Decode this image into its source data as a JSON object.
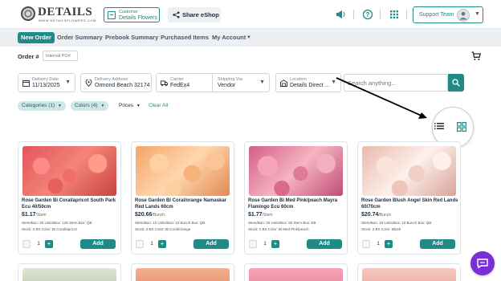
{
  "brand": {
    "logo_text": "DETAILS",
    "logo_subtext": "WWW.DETAILSFLOWERS.COM"
  },
  "header": {
    "customer_label": "Customer",
    "customer_value": "Details Flowers",
    "share_label": "Share eShop",
    "support_label": "Support Team"
  },
  "nav": {
    "items": [
      "New Order",
      "Order Summary",
      "Prebook Summary",
      "Purchased Items",
      "My Account"
    ]
  },
  "order": {
    "label": "Order #",
    "po_placeholder": "Internal PO#"
  },
  "filters": {
    "delivery_date_label": "Delivery Date",
    "delivery_date_value": "11/13/2025",
    "delivery_address_label": "Delivery Address",
    "delivery_address_value": "Ormond Beach 32174",
    "carrier_label": "Carrier",
    "carrier_value": "FedEx4",
    "shipping_via_label": "Shipping Via",
    "shipping_via_value": "Vendor",
    "location_label": "Location",
    "location_value": "Details Direct ...",
    "search_placeholder": "Search anything..."
  },
  "chips": {
    "categories": "Categories (1)",
    "colors": "Colors (4)",
    "prices": "Prices",
    "clear_all": "Clear All"
  },
  "colors": {
    "accent": "#1f8a86",
    "chat": "#7a2ed6"
  },
  "products": [
    {
      "name": "Rose Garden Bi Coral/apricot South Park Ecu 40/50cm",
      "price": "$1.17",
      "unit": "/Stem",
      "meta": "Stem/Bun: 25  Units/Box: 125 Stem  Box: QB",
      "stock_color": "Stock: 2 BX  Color: Bi Coral/apricot",
      "qty": "1",
      "add": "Add"
    },
    {
      "name": "Rose Garden Bi Coral/orange Namaskar Red Lands 60cm",
      "price": "$20.66",
      "unit": "/Bunch",
      "meta": "Stem/Bun: 10  Units/Box: 10 Bunch  Box: QB",
      "stock_color": "Stock: 2 BX  Color: Bi Coral/orange",
      "qty": "1",
      "add": "Add"
    },
    {
      "name": "Rose Garden Bi Med Pink/peach Mayra Flamingo Ecu 60cm",
      "price": "$1.77",
      "unit": "/Stem",
      "meta": "Stem/Bun: 25  Units/Box: 50 Stem  Box: EB",
      "stock_color": "Stock: 1 BX  Color: Bi Med Pink/peach",
      "qty": "1",
      "add": "Add"
    },
    {
      "name": "Rose Garden Blush Angel Skin Red Lands 60/70cm",
      "price": "$20.74",
      "unit": "/Bunch",
      "meta": "Stem/Bun: 10  Units/Box: 10 Bunch  Box: QB",
      "stock_color": "Stock: 2 BX  Color: Blush",
      "qty": "1",
      "add": "Add"
    }
  ]
}
